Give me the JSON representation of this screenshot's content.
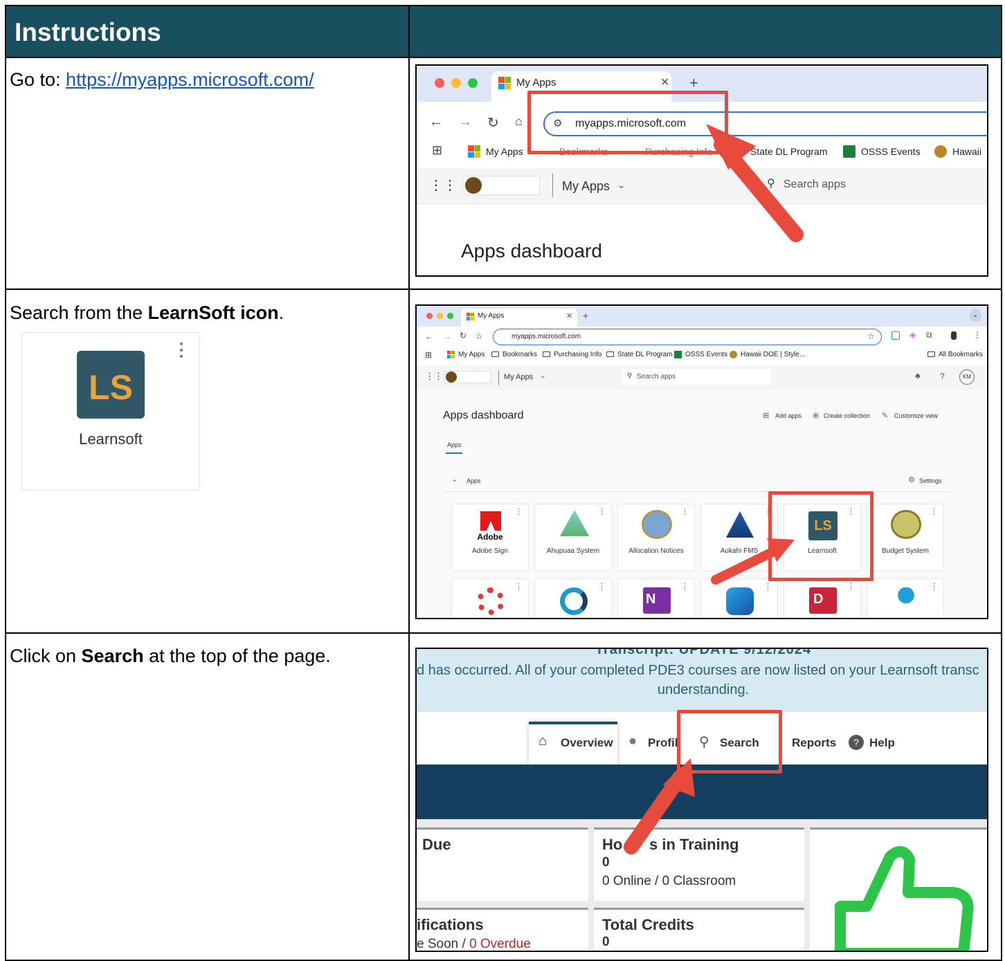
{
  "table": {
    "header_title": "Instructions",
    "rows": [
      {
        "prefix": "Go to: ",
        "link": "https://myapps.microsoft.com/"
      },
      {
        "prefix": "Search from the ",
        "bold": "LearnSoft icon",
        "suffix": "."
      },
      {
        "prefix": "Click on ",
        "bold": "Search",
        "suffix": " at the top of the page."
      }
    ]
  },
  "learnsoft_tile": {
    "icon_text": "LS",
    "label": "Learnsoft"
  },
  "shot1": {
    "tab_title": "My Apps",
    "address": "myapps.microsoft.com",
    "bookmarks": [
      "My Apps",
      "Bookmarks",
      "Purchasing Info",
      "State DL Program",
      "OSSS Events",
      "Hawaii"
    ],
    "app_title": "My Apps",
    "search_placeholder": "Search apps",
    "dashboard_title": "Apps dashboard"
  },
  "shot2": {
    "tab_title": "My Apps",
    "address": "myapps.microsoft.com",
    "bookmarks": [
      "My Apps",
      "Bookmarks",
      "Purchasing Info",
      "State DL Program",
      "OSSS Events",
      "Hawaii DOE | Style..."
    ],
    "all_bookmarks": "All Bookmarks",
    "app_title": "My Apps",
    "search_placeholder": "Search apps",
    "avatar": "KM",
    "dashboard_title": "Apps dashboard",
    "actions": [
      "Add apps",
      "Create collection",
      "Customize view"
    ],
    "apps_tab": "Apps",
    "section": "Apps",
    "settings": "Settings",
    "tiles": [
      "Adobe Sign",
      "Ahupuaa System",
      "Allocation Notices",
      "Aukahi FMS",
      "Learnsoft",
      "Budget System"
    ],
    "adobe_word": "Adobe",
    "learnsoft_icon": "LS",
    "onenote_letter": "N",
    "d_letter": "D"
  },
  "shot3": {
    "banner_line0": "Transcript:   UPDATE 9/12/2024",
    "banner_line1": "d has occurred. All of your completed PDE3 courses are now listed on your Learnsoft transc",
    "banner_line2": "understanding.",
    "nav": [
      "Overview",
      "Profil",
      "Search",
      "Reports",
      "Help"
    ],
    "cards": {
      "due_title": "Due",
      "hours_title_a": "Ho",
      "hours_title_b": "s in Training",
      "hours_value": "0",
      "hours_sub": "0 Online / 0 Classroom",
      "cert_title": "ifications",
      "cert_sub_a": "e Soon / ",
      "cert_sub_b": "0 Overdue",
      "credits_title": "Total Credits",
      "credits_value": "0"
    }
  },
  "colors": {
    "header": "#19505f",
    "link": "#1155cc",
    "highlight": "#e94a3e",
    "learnsoft": "#2f5766",
    "thumb": "#2ec44a"
  }
}
